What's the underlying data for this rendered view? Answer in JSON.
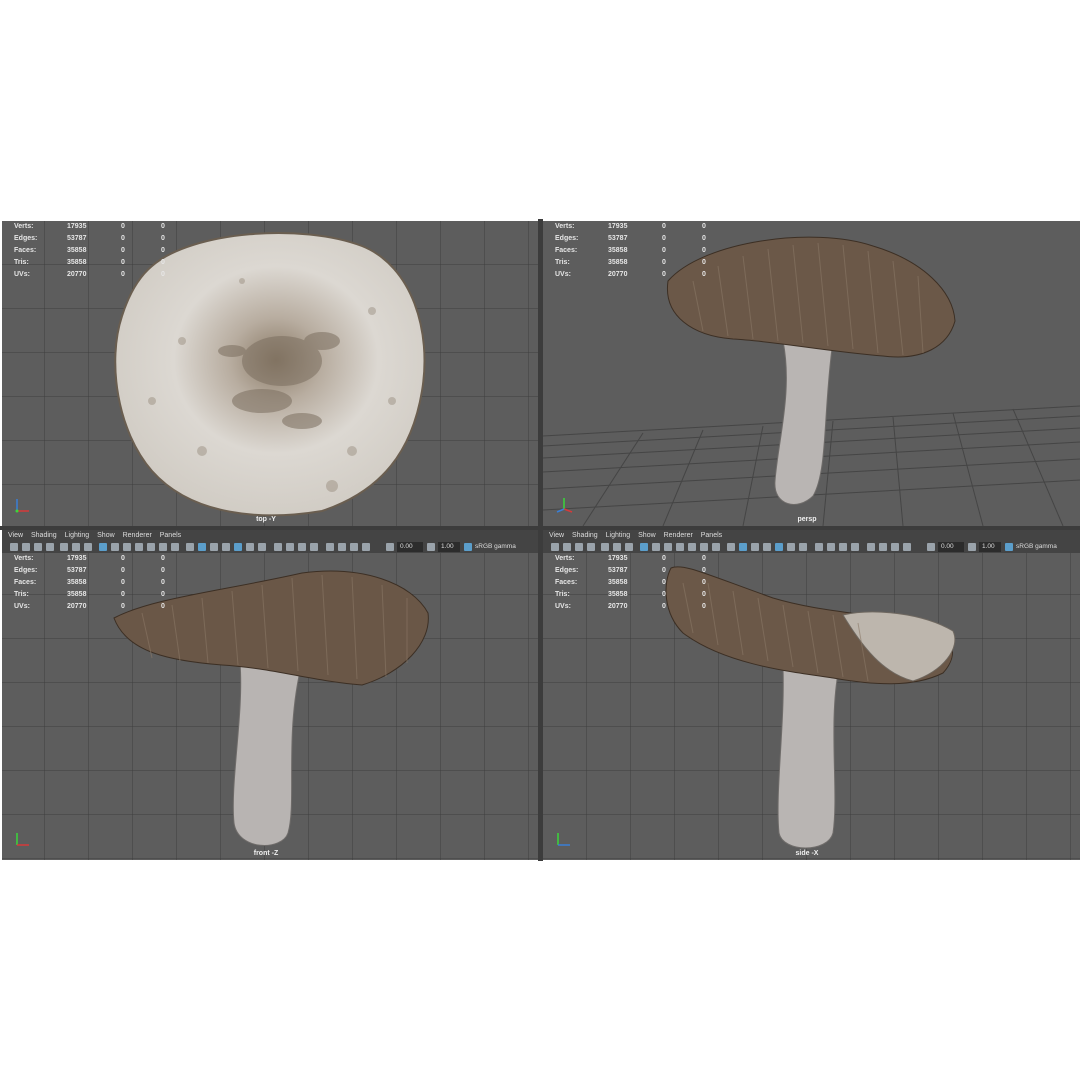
{
  "stats": {
    "labels": [
      "Verts:",
      "Edges:",
      "Faces:",
      "Tris:",
      "UVs:"
    ],
    "values": [
      "17935",
      "53787",
      "35858",
      "35858",
      "20770"
    ],
    "col2": "0",
    "col3": "0"
  },
  "viewports": {
    "top": {
      "camera": "top -Y"
    },
    "persp": {
      "camera": "persp"
    },
    "front": {
      "camera": "front -Z"
    },
    "side": {
      "camera": "side -X"
    }
  },
  "menu": {
    "items": [
      "View",
      "Shading",
      "Lighting",
      "Show",
      "Renderer",
      "Panels"
    ]
  },
  "toolbar": {
    "exposure": "0.00",
    "gamma": "1.00",
    "colorspace": "sRGB gamma"
  },
  "colors": {
    "viewport_bg": "#5d5d5d",
    "grid_line": "#3f3f3f",
    "panel_bar": "#444444",
    "accent_blue": "#5b9ecb"
  }
}
